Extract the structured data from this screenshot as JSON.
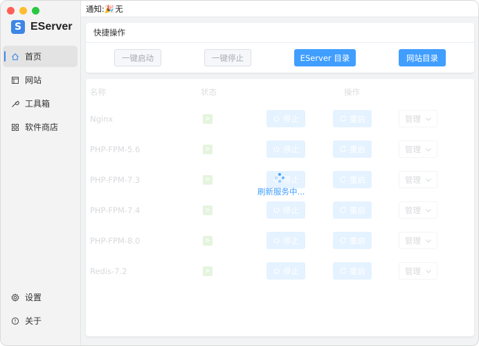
{
  "app": {
    "name": "EServer",
    "logo_letter": "S"
  },
  "notice": {
    "label": "通知:",
    "emoji": "🎉",
    "text": "无"
  },
  "sidebar": {
    "items": [
      {
        "label": "首页",
        "icon": "home-icon",
        "active": true
      },
      {
        "label": "网站",
        "icon": "website-icon"
      },
      {
        "label": "工具箱",
        "icon": "wrench-icon"
      },
      {
        "label": "软件商店",
        "icon": "grid-apps-icon"
      }
    ],
    "bottom": [
      {
        "label": "设置",
        "icon": "gear-icon"
      },
      {
        "label": "关于",
        "icon": "info-icon"
      }
    ]
  },
  "quick_ops": {
    "title": "快捷操作",
    "buttons": [
      {
        "label": "一键启动",
        "state": "disabled"
      },
      {
        "label": "一键停止",
        "state": "disabled"
      },
      {
        "label": "EServer 目录",
        "state": "primary"
      },
      {
        "label": "网站目录",
        "state": "primary"
      }
    ]
  },
  "services": {
    "headers": {
      "name": "名称",
      "status": "状态",
      "actions": "操作"
    },
    "status_symbol": ">",
    "stop_label": "停止",
    "restart_label": "重启",
    "manage_label": "管理",
    "rows": [
      {
        "name": "Nginx"
      },
      {
        "name": "PHP-FPM-5.6"
      },
      {
        "name": "PHP-FPM-7.3"
      },
      {
        "name": "PHP-FPM-7.4"
      },
      {
        "name": "PHP-FPM-8.0"
      },
      {
        "name": "Redis-7.2"
      }
    ]
  },
  "loading": {
    "text": "刷新服务中..."
  },
  "colors": {
    "accent": "#409eff",
    "brand": "#3d86e6",
    "status_running": "#c6e7b7"
  }
}
